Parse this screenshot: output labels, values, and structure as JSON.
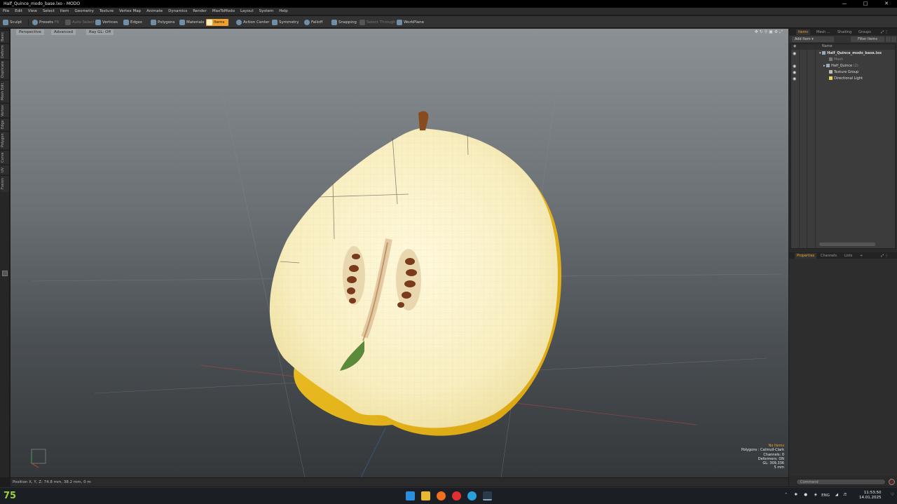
{
  "window": {
    "title": "Half_Quince_modo_base.lxo - MODO"
  },
  "menu": [
    "File",
    "Edit",
    "View",
    "Select",
    "Item",
    "Geometry",
    "Texture",
    "Vertex Map",
    "Animate",
    "Dynamics",
    "Render",
    "MaxToModo",
    "Layout",
    "System",
    "Help"
  ],
  "toolbar": {
    "sculpt": "Sculpt",
    "presets": "Presets",
    "presets_key": "F6",
    "auto_select": "Auto Select",
    "vertices": "Vertices",
    "edges": "Edges",
    "polygons": "Polygons",
    "materials": "Materials",
    "items": "Items",
    "action_center": "Action Center",
    "symmetry": "Symmetry",
    "falloff": "Falloff",
    "snapping": "Snapping",
    "select_through": "Select Through",
    "workplane": "WorkPlane"
  },
  "left_tabs": [
    "Basic",
    "Deform",
    "Duplicate",
    "Mesh Edit",
    "Vertex",
    "Edge",
    "Polygon",
    "Curve",
    "UV",
    "Fusion"
  ],
  "viewport": {
    "view": "Perspective",
    "style": "Advanced",
    "raygl": "Ray GL: Off",
    "hud": {
      "selection": "No Items",
      "polygons": "Polygons : Catmull-Clark",
      "channels": "Channels: 0",
      "deformers": "Deformers: ON",
      "gl": "GL: 309,336",
      "units": "5 mm"
    }
  },
  "status": {
    "position": "Position X, Y, Z:   74.8 mm, 38.2 mm, 0 m"
  },
  "right_panel": {
    "tabs": [
      "Items",
      "Mesh ...",
      "Shading",
      "Groups"
    ],
    "add_item": "Add Item",
    "filter_items": "Filter Items",
    "name_col": "Name",
    "tree": [
      {
        "label": "Half_Quince_modo_base.lxo",
        "indent": 0
      },
      {
        "label": "Mesh",
        "indent": 2
      },
      {
        "label": "Half_Quince",
        "suffix": "(2)",
        "indent": 1
      },
      {
        "label": "Texture Group",
        "indent": 1
      },
      {
        "label": "Directional Light",
        "indent": 1
      }
    ],
    "lower_tabs": [
      "Properties",
      "Channels",
      "Lists"
    ],
    "command_placeholder": "Command"
  },
  "taskbar": {
    "score": "75",
    "lang": "ENG",
    "time": "11:53:50",
    "date": "14.01.2025"
  },
  "colors": {
    "accent": "#f0a030",
    "quince_yellow": "#e8b820",
    "flesh": "#fbf5d0",
    "seed": "#7a3a1c"
  }
}
